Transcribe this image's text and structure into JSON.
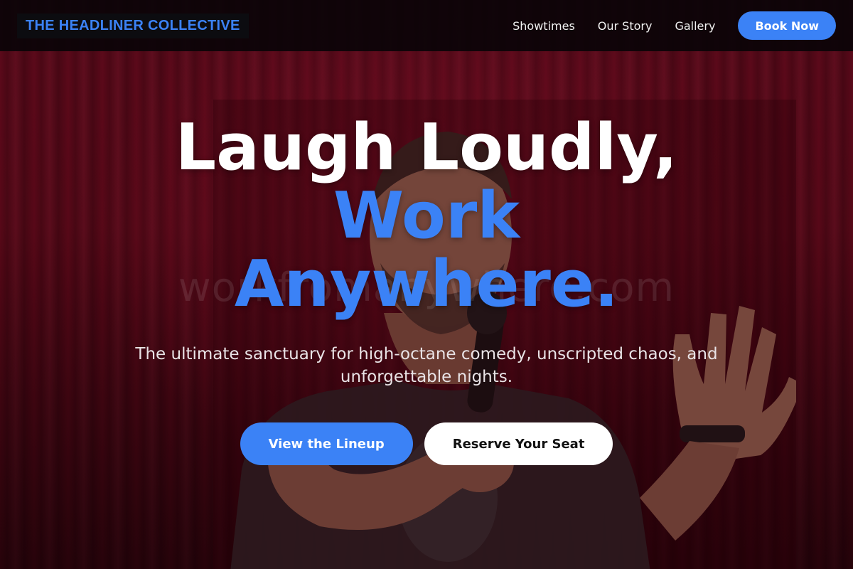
{
  "colors": {
    "accent": "#3b82f6",
    "navbar_bg": "#0a0408",
    "curtain": "#6c0b1f",
    "text_light": "#ffffff"
  },
  "navbar": {
    "brand": "THE HEADLINER COLLECTIVE",
    "links": [
      "Showtimes",
      "Our Story",
      "Gallery"
    ],
    "cta_label": "Book Now"
  },
  "hero": {
    "headline_line1": "Laugh Loudly,",
    "headline_line2": "Work",
    "headline_line3": "Anywhere.",
    "subtitle": "The ultimate sanctuary for high-octane comedy, unscripted chaos, and unforgettable nights.",
    "primary_cta": "View the Lineup",
    "secondary_cta": "Reserve Your Seat",
    "background_image": "comedian-on-stage-photo",
    "watermark": "workfromanywhere.com"
  }
}
